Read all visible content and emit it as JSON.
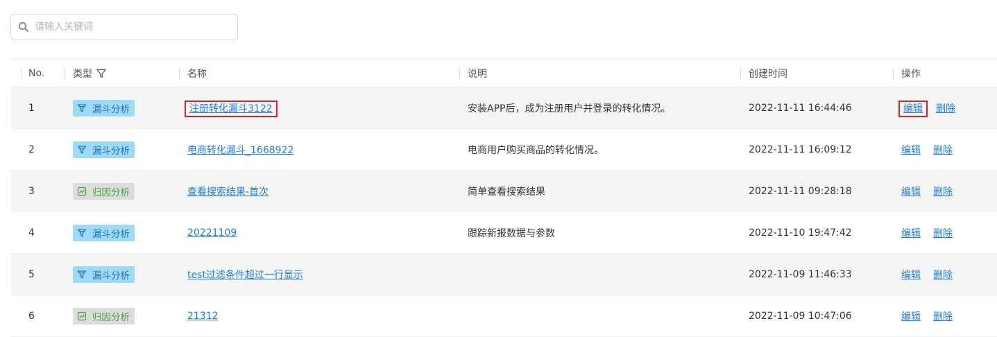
{
  "search": {
    "placeholder": "请输入关键词"
  },
  "table": {
    "headers": {
      "no": "No.",
      "type": "类型",
      "name": "名称",
      "desc": "说明",
      "created": "创建时间",
      "ops": "操作"
    },
    "rows": [
      {
        "no": "1",
        "type": "漏斗分析",
        "type_kind": "funnel",
        "name": "注册转化漏斗3122",
        "desc": "安装APP后，成为注册用户并登录的转化情况。",
        "created": "2022-11-11 16:44:46",
        "edit": "编辑",
        "delete": "删除",
        "highlighted": true
      },
      {
        "no": "2",
        "type": "漏斗分析",
        "type_kind": "funnel",
        "name": "电商转化漏斗_1668922",
        "desc": "电商用户购买商品的转化情况。",
        "created": "2022-11-11 16:09:12",
        "edit": "编辑",
        "delete": "删除"
      },
      {
        "no": "3",
        "type": "归因分析",
        "type_kind": "attribution",
        "name": "查看搜索结果-首次",
        "desc": "简单查看搜索结果",
        "created": "2022-11-11 09:28:18",
        "edit": "编辑",
        "delete": "删除"
      },
      {
        "no": "4",
        "type": "漏斗分析",
        "type_kind": "funnel",
        "name": "20221109",
        "desc": "跟踪新报数据与参数",
        "created": "2022-11-10 19:47:42",
        "edit": "编辑",
        "delete": "删除"
      },
      {
        "no": "5",
        "type": "漏斗分析",
        "type_kind": "funnel",
        "name": "test过滤条件超过一行显示",
        "desc": "",
        "created": "2022-11-09 11:46:33",
        "edit": "编辑",
        "delete": "删除"
      },
      {
        "no": "6",
        "type": "归因分析",
        "type_kind": "attribution",
        "name": "21312",
        "desc": "",
        "created": "2022-11-09 10:47:06",
        "edit": "编辑",
        "delete": "删除"
      }
    ]
  },
  "colors": {
    "link": "#1f7ee0",
    "funnel_tag_bg": "#9fd9f5",
    "funnel_tag_text": "#1a75c4",
    "attribution_tag_bg": "#dcdcdc",
    "attribution_tag_text": "#44a53f",
    "highlight_box": "#e02020",
    "stripe_row_bg": "#f5f5f5"
  },
  "icons": {
    "search": "search-icon",
    "filter": "filter-icon",
    "funnel_tag": "funnel-icon",
    "attribution_tag": "attribution-icon"
  }
}
